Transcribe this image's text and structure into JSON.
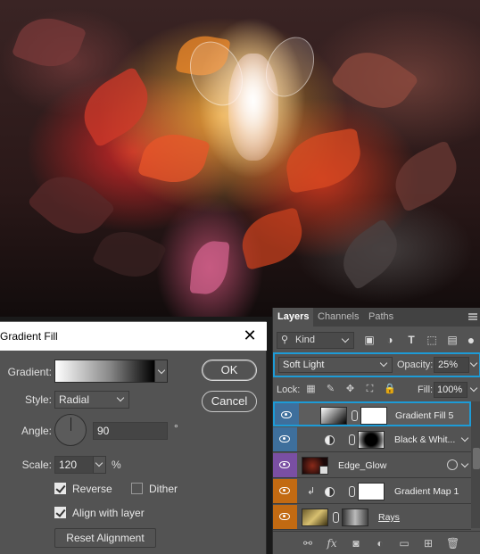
{
  "dialog": {
    "title": "Gradient Fill",
    "close_glyph": "✕",
    "gradient_label": "Gradient:",
    "style_label": "Style:",
    "style_value": "Radial",
    "angle_label": "Angle:",
    "angle_value": "90",
    "degree_symbol": "°",
    "scale_label": "Scale:",
    "scale_value": "120",
    "scale_unit": "%",
    "reverse_label": "Reverse",
    "reverse_checked": true,
    "dither_label": "Dither",
    "dither_checked": false,
    "align_label": "Align with layer",
    "align_checked": true,
    "reset_label": "Reset Alignment",
    "ok_label": "OK",
    "cancel_label": "Cancel"
  },
  "layers_panel": {
    "tabs": [
      {
        "label": "Layers",
        "active": true
      },
      {
        "label": "Channels",
        "active": false
      },
      {
        "label": "Paths",
        "active": false
      }
    ],
    "filter_label": "Kind",
    "blend_mode": "Soft Light",
    "opacity_label": "Opacity:",
    "opacity_value": "25%",
    "lock_label": "Lock:",
    "fill_label": "Fill:",
    "fill_value": "100%",
    "layers": [
      {
        "name": "Gradient Fill 5",
        "selected": true,
        "eye_color": "#3e6f9c",
        "icon": "gradient-fill"
      },
      {
        "name": "Black & Whit...",
        "selected": false,
        "eye_color": "#3e6f9c",
        "icon": "adjustment"
      },
      {
        "name": "Edge_Glow",
        "selected": false,
        "eye_color": "#7a4fa3",
        "icon": "smart-object"
      },
      {
        "name": "Gradient Map 1",
        "selected": false,
        "eye_color": "#c26a12",
        "icon": "adjustment"
      },
      {
        "name": "Rays",
        "selected": false,
        "eye_color": "#c26a12",
        "icon": "pixel-layer"
      }
    ],
    "bottom_icons": [
      "link-icon",
      "fx-icon",
      "mask-icon",
      "adjustment-icon",
      "folder-icon",
      "new-layer-icon",
      "trash-icon"
    ],
    "accent_color": "#1d9bd6"
  }
}
